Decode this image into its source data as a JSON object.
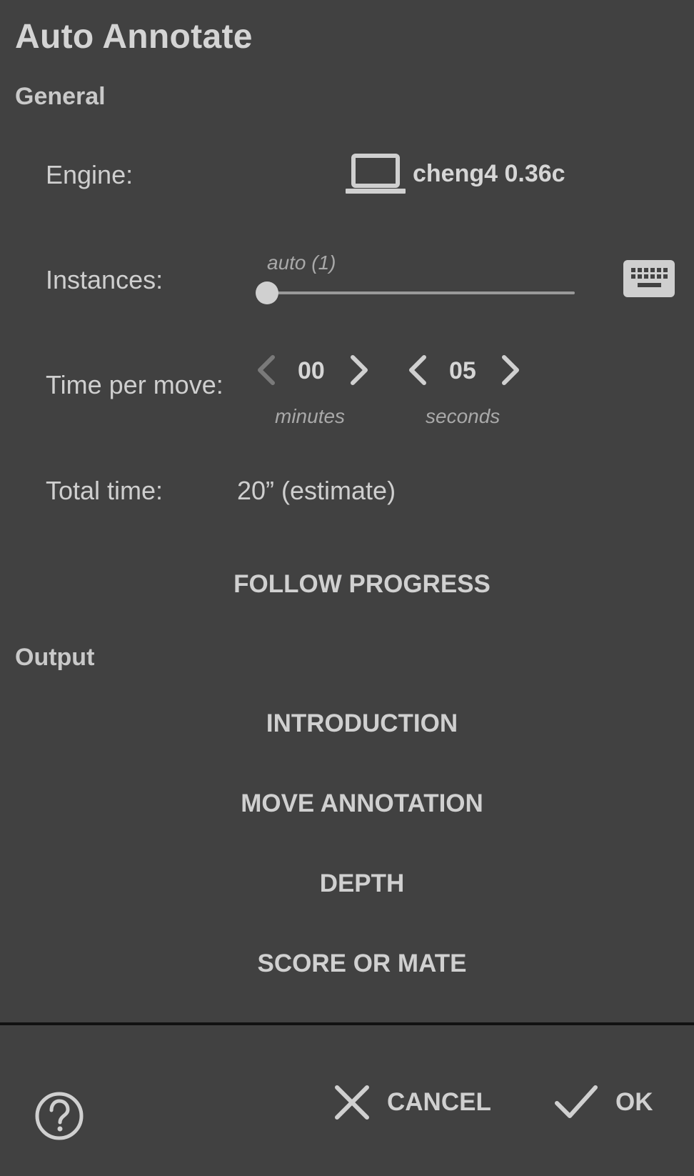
{
  "dialog": {
    "title": "Auto Annotate"
  },
  "general": {
    "heading": "General",
    "engine_label": "Engine:",
    "engine_icon": "laptop-icon",
    "engine_name": "cheng4 0.36c",
    "instances_label": "Instances:",
    "instances_hint": "auto (1)",
    "instances_value": 0,
    "keyboard_icon": "keyboard-icon",
    "time_label": "Time per move:",
    "minutes_value": "00",
    "minutes_unit": "minutes",
    "seconds_value": "05",
    "seconds_unit": "seconds",
    "total_label": "Total time:",
    "total_value": "20” (estimate)",
    "follow_progress": "FOLLOW PROGRESS"
  },
  "output": {
    "heading": "Output",
    "options": [
      "INTRODUCTION",
      "MOVE ANNOTATION",
      "DEPTH",
      "SCORE OR MATE"
    ]
  },
  "footer": {
    "help_icon": "help-circle-icon",
    "cancel_label": "CANCEL",
    "ok_label": "OK"
  },
  "colors": {
    "background": "#414141",
    "text": "#d0d0d0",
    "hint": "#a9a9a9",
    "divider": "#111111"
  }
}
